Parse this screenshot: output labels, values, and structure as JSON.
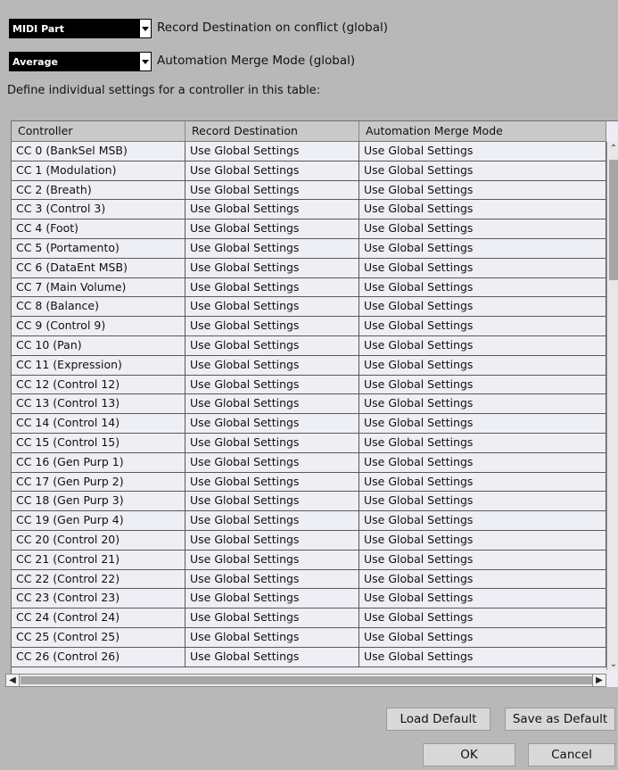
{
  "record_destination": {
    "selected": "MIDI Part",
    "label": "Record Destination on conflict (global)"
  },
  "automation_merge": {
    "selected": "Average",
    "label": "Automation Merge Mode (global)"
  },
  "instruction": "Define individual settings for a controller in this table:",
  "table": {
    "headers": [
      "Controller",
      "Record Destination",
      "Automation Merge Mode"
    ],
    "rows": [
      [
        "CC 0  (BankSel MSB)",
        "Use Global Settings",
        "Use Global Settings"
      ],
      [
        "CC 1  (Modulation)",
        "Use Global Settings",
        "Use Global Settings"
      ],
      [
        "CC 2  (Breath)",
        "Use Global Settings",
        "Use Global Settings"
      ],
      [
        "CC 3  (Control 3)",
        "Use Global Settings",
        "Use Global Settings"
      ],
      [
        "CC 4  (Foot)",
        "Use Global Settings",
        "Use Global Settings"
      ],
      [
        "CC 5  (Portamento)",
        "Use Global Settings",
        "Use Global Settings"
      ],
      [
        "CC 6  (DataEnt MSB)",
        "Use Global Settings",
        "Use Global Settings"
      ],
      [
        "CC 7  (Main Volume)",
        "Use Global Settings",
        "Use Global Settings"
      ],
      [
        "CC 8  (Balance)",
        "Use Global Settings",
        "Use Global Settings"
      ],
      [
        "CC 9  (Control 9)",
        "Use Global Settings",
        "Use Global Settings"
      ],
      [
        "CC 10  (Pan)",
        "Use Global Settings",
        "Use Global Settings"
      ],
      [
        "CC 11  (Expression)",
        "Use Global Settings",
        "Use Global Settings"
      ],
      [
        "CC 12  (Control 12)",
        "Use Global Settings",
        "Use Global Settings"
      ],
      [
        "CC 13  (Control 13)",
        "Use Global Settings",
        "Use Global Settings"
      ],
      [
        "CC 14  (Control 14)",
        "Use Global Settings",
        "Use Global Settings"
      ],
      [
        "CC 15  (Control 15)",
        "Use Global Settings",
        "Use Global Settings"
      ],
      [
        "CC 16  (Gen Purp 1)",
        "Use Global Settings",
        "Use Global Settings"
      ],
      [
        "CC 17  (Gen Purp 2)",
        "Use Global Settings",
        "Use Global Settings"
      ],
      [
        "CC 18  (Gen Purp 3)",
        "Use Global Settings",
        "Use Global Settings"
      ],
      [
        "CC 19  (Gen Purp 4)",
        "Use Global Settings",
        "Use Global Settings"
      ],
      [
        "CC 20  (Control 20)",
        "Use Global Settings",
        "Use Global Settings"
      ],
      [
        "CC 21  (Control 21)",
        "Use Global Settings",
        "Use Global Settings"
      ],
      [
        "CC 22  (Control 22)",
        "Use Global Settings",
        "Use Global Settings"
      ],
      [
        "CC 23  (Control 23)",
        "Use Global Settings",
        "Use Global Settings"
      ],
      [
        "CC 24  (Control 24)",
        "Use Global Settings",
        "Use Global Settings"
      ],
      [
        "CC 25  (Control 25)",
        "Use Global Settings",
        "Use Global Settings"
      ],
      [
        "CC 26  (Control 26)",
        "Use Global Settings",
        "Use Global Settings"
      ]
    ]
  },
  "buttons": {
    "load_default": "Load Default",
    "save_as_default": "Save as Default",
    "ok": "OK",
    "cancel": "Cancel"
  }
}
